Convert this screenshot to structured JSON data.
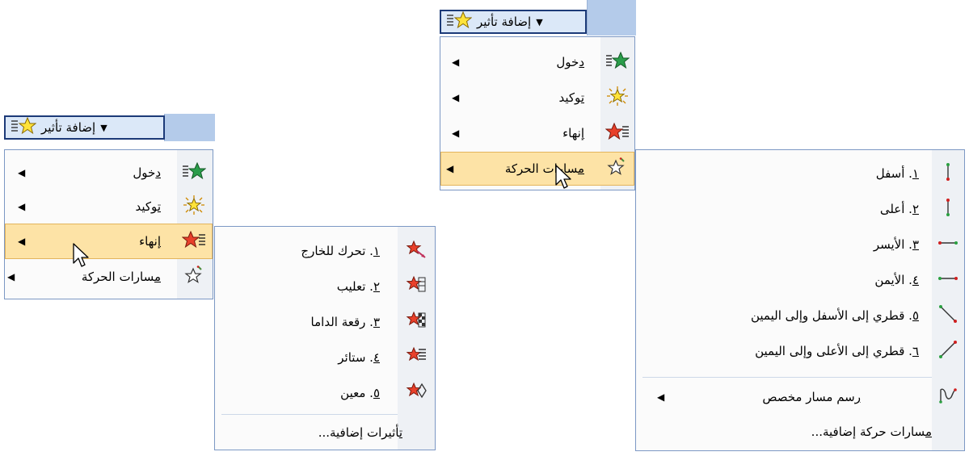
{
  "left_panel": {
    "add_effect_label": "إضافة تأثير",
    "menu": [
      {
        "key": "د",
        "rest": "خول",
        "icon": "entrance-star-icon"
      },
      {
        "key": "ت",
        "rest": "وكيد",
        "icon": "emphasis-star-icon"
      },
      {
        "key": "إ",
        "rest": "نهاء",
        "icon": "exit-star-icon"
      },
      {
        "key": "م",
        "rest": "سارات الحركة",
        "icon": "motion-path-star-icon"
      }
    ],
    "submenu": {
      "items": [
        {
          "num": "١",
          "rest": ". تحرك للخارج",
          "icon": "fly-out-icon"
        },
        {
          "num": "٢",
          "rest": ". تعليب",
          "icon": "box-effect-icon"
        },
        {
          "num": "٣",
          "rest": ". رقعة الداما",
          "icon": "checkerboard-icon"
        },
        {
          "num": "٤",
          "rest": ". ستائر",
          "icon": "blinds-icon"
        },
        {
          "num": "٥",
          "rest": ". معين",
          "icon": "diamond-icon"
        }
      ],
      "more_key": "ت",
      "more_rest": "أثيرات إضافية..."
    }
  },
  "right_panel": {
    "add_effect_label": "إضافة تأثير",
    "menu": [
      {
        "key": "د",
        "rest": "خول",
        "icon": "entrance-star-icon"
      },
      {
        "key": "ت",
        "rest": "وكيد",
        "icon": "emphasis-star-icon"
      },
      {
        "key": "إ",
        "rest": "نهاء",
        "icon": "exit-star-icon"
      },
      {
        "key": "م",
        "rest": "سارات الحركة",
        "icon": "motion-path-star-icon"
      }
    ],
    "submenu": {
      "items": [
        {
          "num": "١",
          "rest": ". أسفل",
          "icon": "down-path-icon"
        },
        {
          "num": "٢",
          "rest": ". أعلى",
          "icon": "up-path-icon"
        },
        {
          "num": "٣",
          "rest": ". الأيسر",
          "icon": "left-path-icon"
        },
        {
          "num": "٤",
          "rest": ". الأيمن",
          "icon": "right-path-icon"
        },
        {
          "num": "٥",
          "rest": ". قطري إلى الأسفل وإلى اليمين",
          "icon": "diagonal-down-right-icon"
        },
        {
          "num": "٦",
          "rest": ". قطري إلى الأعلى وإلى اليمين",
          "icon": "diagonal-up-right-icon"
        }
      ],
      "draw_key": "ر",
      "draw_rest": "سم مسار مخصص",
      "more_key": "م",
      "more_rest": "سارات حركة إضافية..."
    }
  }
}
